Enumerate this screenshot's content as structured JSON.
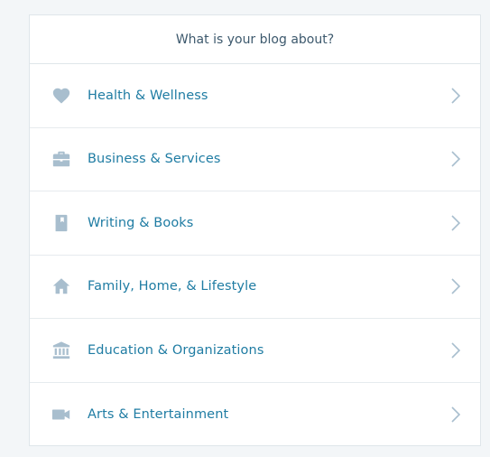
{
  "header": {
    "title": "What is your blog about?"
  },
  "categories": [
    {
      "label": "Health & Wellness",
      "icon": "heart-icon"
    },
    {
      "label": "Business & Services",
      "icon": "briefcase-icon"
    },
    {
      "label": "Writing & Books",
      "icon": "book-icon"
    },
    {
      "label": "Family, Home, & Lifestyle",
      "icon": "house-icon"
    },
    {
      "label": "Education & Organizations",
      "icon": "institution-icon"
    },
    {
      "label": "Arts & Entertainment",
      "icon": "video-camera-icon"
    }
  ],
  "colors": {
    "label": "#1f7ca3",
    "icon": "#a8bece",
    "header_text": "#3d596d",
    "background": "#f3f6f8"
  }
}
